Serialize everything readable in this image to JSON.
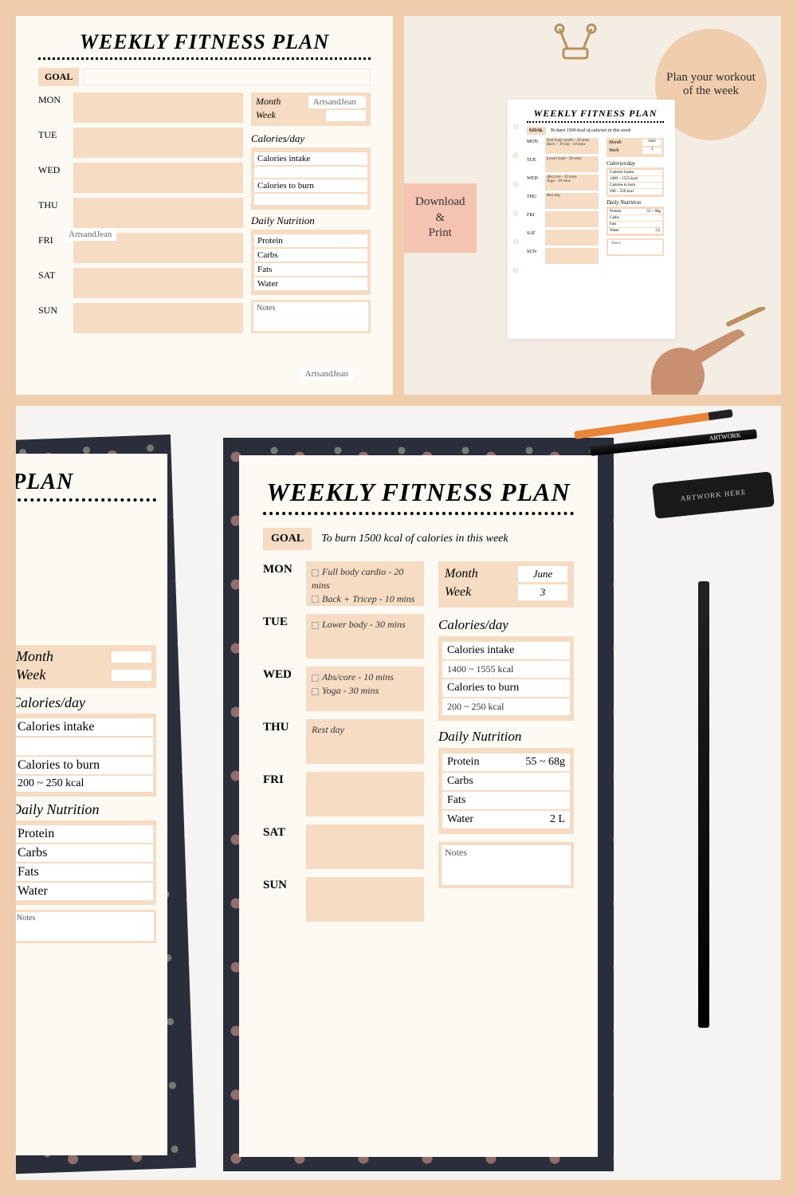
{
  "title": "WEEKLY FITNESS PLAN",
  "goal_label": "GOAL",
  "goal_text": "To burn 1500 kcal of calories in this week",
  "days": [
    "MON",
    "TUE",
    "WED",
    "THU",
    "FRI",
    "SAT",
    "SUN"
  ],
  "day_entries": {
    "MON": [
      "Full body cardio - 20 mins",
      "Back + Tricep - 10 mins"
    ],
    "TUE": [
      "Lower body - 30 mins"
    ],
    "WED": [
      "Abs/core - 10 mins",
      "Yoga - 30 mins"
    ],
    "THU": [
      "Rest day"
    ],
    "FRI": [],
    "SAT": [],
    "SUN": []
  },
  "month_label": "Month",
  "week_label": "Week",
  "month_value": "June",
  "week_value": "3",
  "calories_header": "Calories/day",
  "calories_intake_label": "Calories intake",
  "calories_intake_value": "1400 ~ 1555 kcal",
  "calories_burn_label": "Calories to burn",
  "calories_burn_value": "200 ~ 250 kcal",
  "nutrition_header": "Daily Nutrition",
  "nutrition": [
    {
      "label": "Protein",
      "value": "55 ~ 68g"
    },
    {
      "label": "Carbs",
      "value": ""
    },
    {
      "label": "Fats",
      "value": ""
    },
    {
      "label": "Water",
      "value": "2 L"
    }
  ],
  "notes_label": "Notes",
  "watermark": "ArtsandJean",
  "circle_text": "Plan your workout of the week",
  "download_print": "Download\n&\nPrint",
  "pencil_text": "ARTWORK",
  "eraser_text": "ARTWORK HERE"
}
